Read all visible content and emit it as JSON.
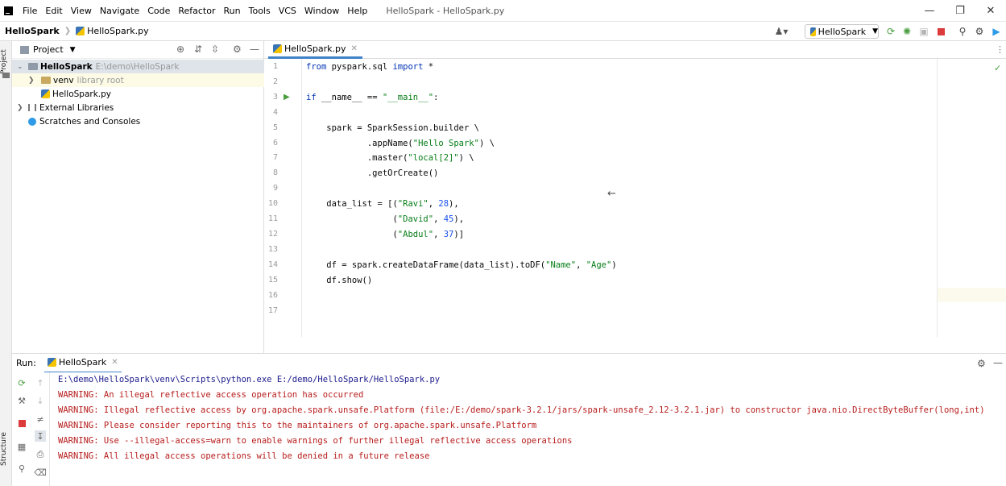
{
  "menubar": {
    "items": [
      "File",
      "Edit",
      "View",
      "Navigate",
      "Code",
      "Refactor",
      "Run",
      "Tools",
      "VCS",
      "Window",
      "Help"
    ],
    "window_title": "HelloSpark - HelloSpark.py"
  },
  "navbar": {
    "project": "HelloSpark",
    "file": "HelloSpark.py",
    "run_config": "HelloSpark"
  },
  "left_stripe": {
    "project_label": "Project",
    "structure_label": "Structure"
  },
  "project_panel": {
    "title": "Project",
    "root_name": "HelloSpark",
    "root_path": "E:\\demo\\HelloSpark",
    "venv_name": "venv",
    "venv_hint": "library root",
    "file_name": "HelloSpark.py",
    "external_libraries": "External Libraries",
    "scratches": "Scratches and Consoles"
  },
  "editor": {
    "tab_label": "HelloSpark.py",
    "line_numbers": [
      "1",
      "2",
      "3",
      "4",
      "5",
      "6",
      "7",
      "8",
      "9",
      "10",
      "11",
      "12",
      "13",
      "14",
      "15",
      "16",
      "17"
    ]
  },
  "run_panel": {
    "label": "Run:",
    "tab": "HelloSpark",
    "lines": [
      "E:\\demo\\HelloSpark\\venv\\Scripts\\python.exe E:/demo/HelloSpark/HelloSpark.py",
      "WARNING: An illegal reflective access operation has occurred",
      "WARNING: Illegal reflective access by org.apache.spark.unsafe.Platform (file:/E:/demo/spark-3.2.1/jars/spark-unsafe_2.12-3.2.1.jar) to constructor java.nio.DirectByteBuffer(long,int)",
      "WARNING: Please consider reporting this to the maintainers of org.apache.spark.unsafe.Platform",
      "WARNING: Use --illegal-access=warn to enable warnings of further illegal reflective access operations",
      "WARNING: All illegal access operations will be denied in a future release"
    ]
  },
  "colors": {
    "keyword": "#0033b3",
    "string": "#067d17",
    "number": "#1750eb",
    "warning": "#b71c1c",
    "command": "#1a1a8c"
  }
}
